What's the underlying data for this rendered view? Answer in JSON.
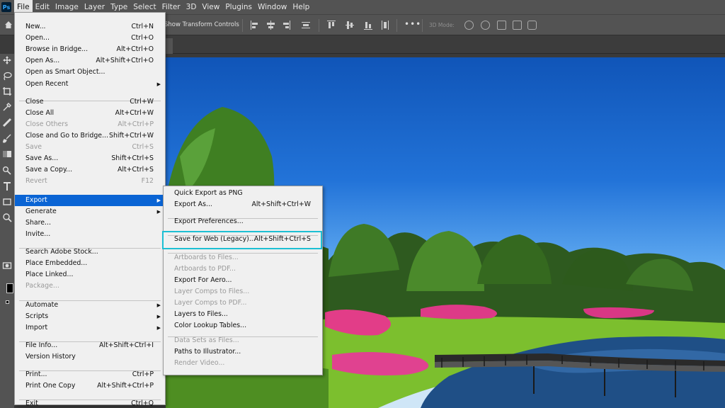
{
  "app": {
    "logo_text": "Ps"
  },
  "menubar": [
    "File",
    "Edit",
    "Image",
    "Layer",
    "Type",
    "Select",
    "Filter",
    "3D",
    "View",
    "Plugins",
    "Window",
    "Help"
  ],
  "options": {
    "transform_label": "Show Transform Controls",
    "more_label": "•••",
    "mode_3d": "3D Mode:"
  },
  "file_menu": [
    {
      "label": "New...",
      "shortcut": "Ctrl+N"
    },
    {
      "label": "Open...",
      "shortcut": "Ctrl+O"
    },
    {
      "label": "Browse in Bridge...",
      "shortcut": "Alt+Ctrl+O"
    },
    {
      "label": "Open As...",
      "shortcut": "Alt+Shift+Ctrl+O"
    },
    {
      "label": "Open as Smart Object...",
      "shortcut": ""
    },
    {
      "label": "Open Recent",
      "shortcut": ""
    },
    {
      "label": "Close",
      "shortcut": "Ctrl+W"
    },
    {
      "label": "Close All",
      "shortcut": "Alt+Ctrl+W"
    },
    {
      "label": "Close Others",
      "shortcut": "Alt+Ctrl+P"
    },
    {
      "label": "Close and Go to Bridge...",
      "shortcut": "Shift+Ctrl+W"
    },
    {
      "label": "Save",
      "shortcut": "Ctrl+S"
    },
    {
      "label": "Save As...",
      "shortcut": "Shift+Ctrl+S"
    },
    {
      "label": "Save a Copy...",
      "shortcut": "Alt+Ctrl+S"
    },
    {
      "label": "Revert",
      "shortcut": "F12"
    },
    {
      "label": "Export",
      "shortcut": ""
    },
    {
      "label": "Generate",
      "shortcut": ""
    },
    {
      "label": "Share...",
      "shortcut": ""
    },
    {
      "label": "Invite...",
      "shortcut": ""
    },
    {
      "label": "Search Adobe Stock...",
      "shortcut": ""
    },
    {
      "label": "Place Embedded...",
      "shortcut": ""
    },
    {
      "label": "Place Linked...",
      "shortcut": ""
    },
    {
      "label": "Package...",
      "shortcut": ""
    },
    {
      "label": "Automate",
      "shortcut": ""
    },
    {
      "label": "Scripts",
      "shortcut": ""
    },
    {
      "label": "Import",
      "shortcut": ""
    },
    {
      "label": "File Info...",
      "shortcut": "Alt+Shift+Ctrl+I"
    },
    {
      "label": "Version History",
      "shortcut": ""
    },
    {
      "label": "Print...",
      "shortcut": "Ctrl+P"
    },
    {
      "label": "Print One Copy",
      "shortcut": "Alt+Shift+Ctrl+P"
    },
    {
      "label": "Exit",
      "shortcut": "Ctrl+Q"
    }
  ],
  "export_menu": [
    {
      "label": "Quick Export as PNG",
      "shortcut": ""
    },
    {
      "label": "Export As...",
      "shortcut": "Alt+Shift+Ctrl+W"
    },
    {
      "label": "Export Preferences...",
      "shortcut": ""
    },
    {
      "label": "Save for Web (Legacy)...",
      "shortcut": "Alt+Shift+Ctrl+S"
    },
    {
      "label": "Artboards to Files...",
      "shortcut": ""
    },
    {
      "label": "Artboards to PDF...",
      "shortcut": ""
    },
    {
      "label": "Export For Aero...",
      "shortcut": ""
    },
    {
      "label": "Layer Comps to Files...",
      "shortcut": ""
    },
    {
      "label": "Layer Comps to PDF...",
      "shortcut": ""
    },
    {
      "label": "Layers to Files...",
      "shortcut": ""
    },
    {
      "label": "Color Lookup Tables...",
      "shortcut": ""
    },
    {
      "label": "Data Sets as Files...",
      "shortcut": ""
    },
    {
      "label": "Paths to Illustrator...",
      "shortcut": ""
    },
    {
      "label": "Render Video...",
      "shortcut": ""
    }
  ],
  "colors": {
    "highlight": "#0a64d4",
    "focus_outline": "#1dbfd3",
    "menu_bg": "#f0f0f0",
    "chrome": "#535353"
  }
}
